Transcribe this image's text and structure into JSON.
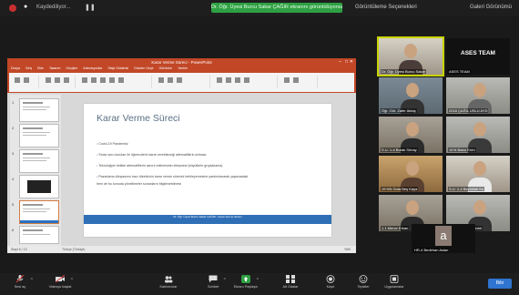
{
  "topbar": {
    "recording_label": "Kaydediliyor...",
    "banner": "Dr. Öğr. Üyesi Burcu Sakar ÇAĞIR ekranını görüntülüyorsunuz",
    "view_options": "Görüntüleme Seçenekleri",
    "gallery_view": "Galeri Görünümü"
  },
  "share": {
    "window_title": "Karar Verme Süreci - PowerPoint",
    "ribbon_tabs": [
      "Dosya",
      "Giriş",
      "Ekle",
      "Tasarım",
      "Geçişler",
      "Animasyonlar",
      "Slayt Gösterisi",
      "Gözden Geçir",
      "Görünüm",
      "Yardım"
    ],
    "slide": {
      "title": "Karar Verme Süreci",
      "bullets": [
        "Covid-19 Pandemisi",
        "Sınav soru kuruları ile öğrencilerin karar verebileceği alternatiflerin artması",
        "Teknolojiyle birlikte alternatiflerin sanırlı edilmesinin elleşmesi (büyütlerle gruplarlama)",
        "Pazarlama dünyasının bazı tüketicinin karar verme sürecini belirleyemesine yardımlanarak yaşamadaki"
      ],
      "bullet_cont": "hem de bu konuda yönelilmeler sunanların bilgilenebilmesi",
      "footer": "Dr. Öğr. Üyesi Burcu Sakar ÇAĞIR - Karar Verme Süreci"
    },
    "status": {
      "slide_counter": "Slayt 6 / 13",
      "language": "Türkçe (Türkiye)",
      "zoom": "%59"
    }
  },
  "participants": [
    {
      "name": "Dr. Öğr. Üyesi Burcu Sakar",
      "type": "video"
    },
    {
      "name": "ASES TEAM",
      "type": "team"
    },
    {
      "name": "Öğr. Gör. Zafer Aktaş",
      "type": "video"
    },
    {
      "name": "2018 ÇAĞIL USLU AYD",
      "type": "video"
    },
    {
      "name": "S.U. 1-4 Burak Sönay",
      "type": "video"
    },
    {
      "name": "19 N Batur Eren",
      "type": "video"
    },
    {
      "name": "19 HN Gıda Beş Kaya",
      "type": "video"
    },
    {
      "name": "S.U. 1-4 Beytullah Ko",
      "type": "video"
    },
    {
      "name": "1.1 Merve Erkan",
      "type": "video"
    },
    {
      "name": "3 Bu-Talha Taşdemir",
      "type": "video"
    },
    {
      "name": "HR-4 Bedirhan Aslan",
      "type": "avatar",
      "initial": "a"
    }
  ],
  "toolbar": {
    "items": [
      {
        "label": "Sesi aç",
        "icon": "microphone-icon"
      },
      {
        "label": "Videoyu başlat",
        "icon": "video-camera-icon"
      },
      {
        "label": "Katılımcılar",
        "icon": "participants-icon"
      },
      {
        "label": "Sohbet",
        "icon": "chat-icon"
      },
      {
        "label": "Ekranı Paylaşın",
        "icon": "share-screen-icon"
      },
      {
        "label": "Alt Odalar",
        "icon": "breakout-rooms-icon"
      },
      {
        "label": "Kayıt",
        "icon": "record-icon"
      },
      {
        "label": "Tepkiler",
        "icon": "reactions-icon"
      },
      {
        "label": "Uygulamalar",
        "icon": "apps-icon"
      }
    ],
    "end_label": "Bitir",
    "colors": {
      "share_green": "#2ea043",
      "end_blue": "#2f74d0",
      "active_tile": "#c9d400"
    }
  }
}
